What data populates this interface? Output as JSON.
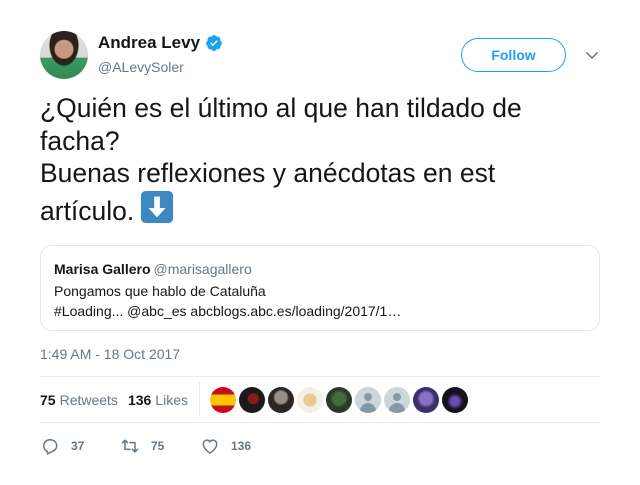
{
  "author": {
    "name": "Andrea Levy",
    "handle": "@ALevySoler",
    "verified": true
  },
  "follow_label": "Follow",
  "tweet": {
    "lines": [
      "¿Quién es el último al que han tildado de",
      "facha?",
      "Buenas reflexiones y anécdotas en est",
      "artículo."
    ],
    "emoji": "down-arrow-emoji"
  },
  "quoted": {
    "name": "Marisa Gallero",
    "handle": "@marisagallero",
    "line1": "Pongamos que hablo de Cataluña",
    "line2": "#Loading... @abc_es abcblogs.abc.es/loading/2017/1…"
  },
  "timestamp": "1:49 AM - 18 Oct 2017",
  "stats": {
    "retweets_count": "75",
    "retweets_label": "Retweets",
    "likes_count": "136",
    "likes_label": "Likes"
  },
  "actions": {
    "reply_count": "37",
    "retweet_count": "75",
    "like_count": "136"
  },
  "colors": {
    "accent": "#1da1f2",
    "text": "#14171a",
    "muted": "#657786",
    "border": "#e1e8ed"
  }
}
